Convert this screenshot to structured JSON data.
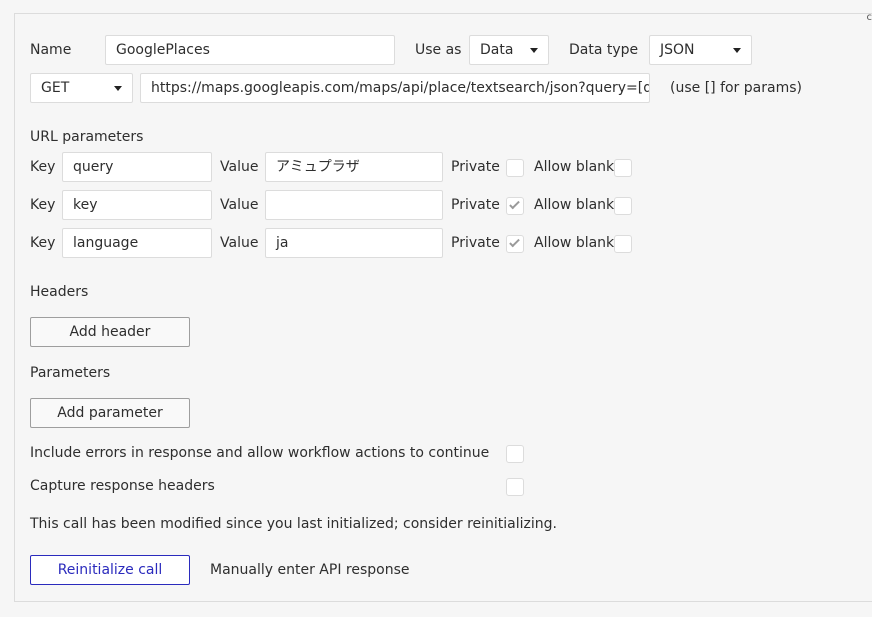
{
  "call": {
    "name_label": "Name",
    "name_value": "GooglePlaces",
    "use_as_label": "Use as",
    "use_as_value": "Data",
    "data_type_label": "Data type",
    "data_type_value": "JSON",
    "method_value": "GET",
    "url_value": "https://maps.googleapis.com/maps/api/place/textsearch/json?query=[query]",
    "url_hint": "(use [] for params)"
  },
  "url_parameters": {
    "heading": "URL parameters",
    "key_label": "Key",
    "value_label": "Value",
    "private_label": "Private",
    "allow_blank_label": "Allow blank",
    "rows": [
      {
        "key": "query",
        "value": "アミュプラザ",
        "private": false,
        "allow_blank": false
      },
      {
        "key": "key",
        "value": "",
        "private": true,
        "allow_blank": false
      },
      {
        "key": "language",
        "value": "ja",
        "private": true,
        "allow_blank": false
      }
    ]
  },
  "headers": {
    "heading": "Headers",
    "add_button": "Add header"
  },
  "parameters": {
    "heading": "Parameters",
    "add_button": "Add parameter"
  },
  "options": {
    "include_errors_label": "Include errors in response and allow workflow actions to continue",
    "include_errors_checked": false,
    "capture_headers_label": "Capture response headers",
    "capture_headers_checked": false
  },
  "status_message": "This call has been modified since you last initialized; consider reinitializing.",
  "actions": {
    "reinitialize_label": "Reinitialize call",
    "manual_label": "Manually enter API response"
  },
  "colors": {
    "accent": "#2b2bbd",
    "border": "#dcdcdc",
    "background": "#f6f6f6"
  }
}
